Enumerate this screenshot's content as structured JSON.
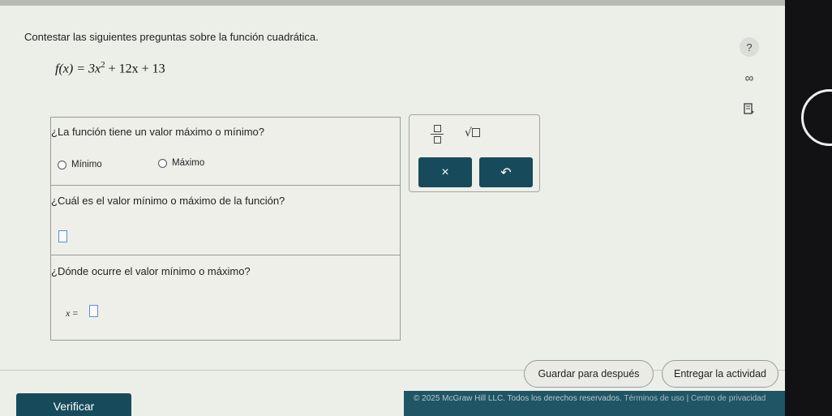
{
  "instruction": "Contestar las siguientes preguntas sobre la función cuadrática.",
  "formula": {
    "lhs": "f(x) = 3x",
    "exp": "2",
    "rest": "+ 12x + 13"
  },
  "side_icons": {
    "help": "?",
    "infinity": "∞",
    "book": "book-icon"
  },
  "question1": {
    "text": "¿La función tiene un valor máximo o mínimo?",
    "options": [
      "Mínimo",
      "Máximo"
    ]
  },
  "question2": {
    "text": "¿Cuál es el valor mínimo o máximo de la función?"
  },
  "question3": {
    "text": "¿Dónde ocurre el valor mínimo o máximo?",
    "var_label": "x",
    "equals": "="
  },
  "tools": {
    "clear_label": "×",
    "undo_label": "↶"
  },
  "footer": {
    "save_label": "Guardar para después",
    "submit_label": "Entregar la actividad",
    "verify_label": "Verificar",
    "copyright": "© 2025 McGraw Hill LLC. Todos los derechos reservados.",
    "terms": "Términos de uso",
    "separator": "|",
    "privacy": "Centro de privacidad"
  },
  "colors": {
    "accent": "#174b5c",
    "answer_outline": "#5a8fd6"
  }
}
